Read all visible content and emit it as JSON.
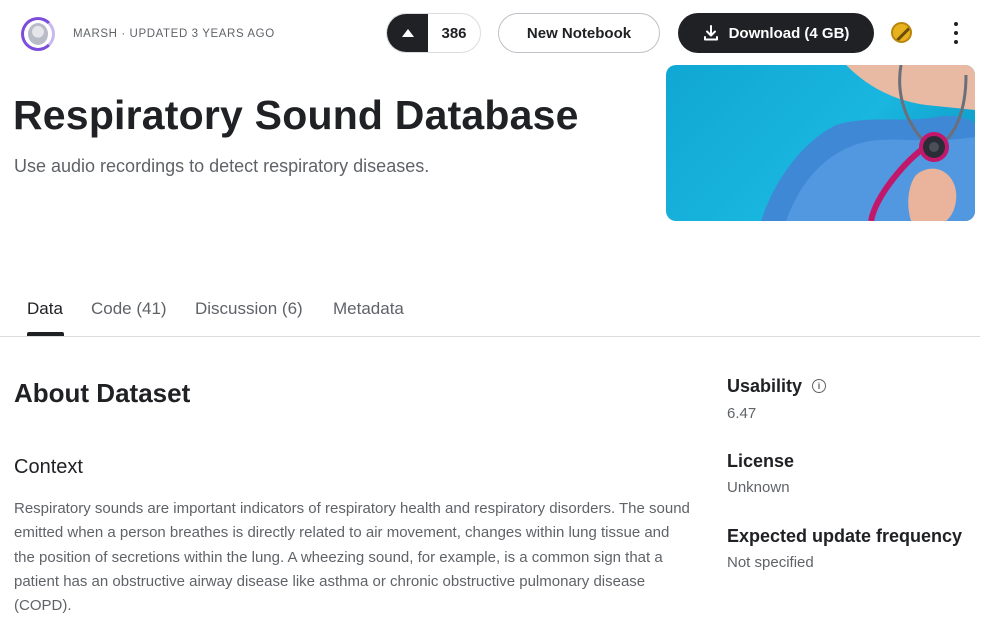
{
  "header": {
    "byline": "MARSH · UPDATED 3 YEARS AGO",
    "vote_count": "386",
    "new_notebook_label": "New Notebook",
    "download_label": "Download (4 GB)"
  },
  "dataset": {
    "title": "Respiratory Sound Database",
    "subtitle": "Use audio recordings to detect respiratory diseases."
  },
  "tabs": [
    {
      "label": "Data",
      "active": true
    },
    {
      "label": "Code (41)",
      "active": false
    },
    {
      "label": "Discussion (6)",
      "active": false
    },
    {
      "label": "Metadata",
      "active": false
    }
  ],
  "about": {
    "heading": "About Dataset",
    "context_heading": "Context",
    "context_text": "Respiratory sounds are important indicators of respiratory health and respiratory disorders. The sound emitted when a person breathes is directly related to air movement, changes within lung tissue and the position of secretions within the lung. A wheezing sound, for example, is a common sign that a patient has an obstructive airway disease like asthma or chronic obstructive pulmonary disease (COPD)."
  },
  "sidebar": {
    "usability_label": "Usability",
    "usability_value": "6.47",
    "license_label": "License",
    "license_value": "Unknown",
    "update_label": "Expected update frequency",
    "update_value": "Not specified"
  },
  "icons": {
    "upvote": "triangle-up-icon",
    "download": "download-icon",
    "medal": "medal-icon",
    "more": "kebab-menu-icon",
    "info": "info-icon"
  },
  "colors": {
    "primary_dark": "#202124",
    "secondary_text": "#5f6368",
    "avatar_ring": "#7c4ddb",
    "medal_gold": "#e8b21f",
    "hero_blue": "#19b6df"
  }
}
